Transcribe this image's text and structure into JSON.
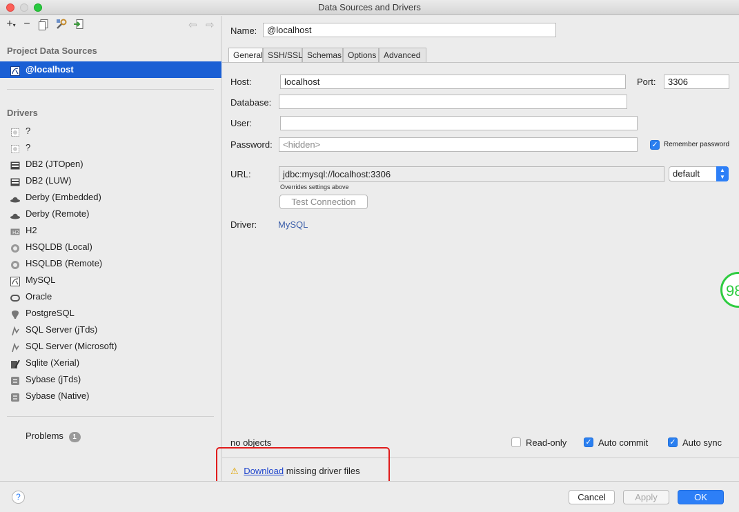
{
  "window": {
    "title": "Data Sources and Drivers"
  },
  "toolbar": {
    "add": "+",
    "add_chevron": "▾",
    "remove": "−"
  },
  "left": {
    "project_title": "Project Data Sources",
    "selected_source": "@localhost",
    "drivers_title": "Drivers",
    "drivers": [
      {
        "label": "?",
        "icon": "generic-driver-icon"
      },
      {
        "label": "?",
        "icon": "generic-driver-icon"
      },
      {
        "label": "DB2 (JTOpen)",
        "icon": "db2-icon"
      },
      {
        "label": "DB2 (LUW)",
        "icon": "db2-icon"
      },
      {
        "label": "Derby (Embedded)",
        "icon": "derby-hat-icon"
      },
      {
        "label": "Derby (Remote)",
        "icon": "derby-hat-icon"
      },
      {
        "label": "H2",
        "icon": "h2-icon"
      },
      {
        "label": "HSQLDB (Local)",
        "icon": "hsqldb-icon"
      },
      {
        "label": "HSQLDB (Remote)",
        "icon": "hsqldb-icon"
      },
      {
        "label": "MySQL",
        "icon": "mysql-icon"
      },
      {
        "label": "Oracle",
        "icon": "oracle-icon"
      },
      {
        "label": "PostgreSQL",
        "icon": "postgresql-icon"
      },
      {
        "label": "SQL Server (jTds)",
        "icon": "sqlserver-icon"
      },
      {
        "label": "SQL Server (Microsoft)",
        "icon": "sqlserver-icon"
      },
      {
        "label": "Sqlite (Xerial)",
        "icon": "sqlite-icon"
      },
      {
        "label": "Sybase (jTds)",
        "icon": "sybase-icon"
      },
      {
        "label": "Sybase (Native)",
        "icon": "sybase-icon"
      }
    ],
    "problems_label": "Problems",
    "problems_count": "1"
  },
  "form": {
    "name_label": "Name:",
    "name_value": "@localhost",
    "tabs": [
      "General",
      "SSH/SSL",
      "Schemas",
      "Options",
      "Advanced"
    ],
    "host_label": "Host:",
    "host_value": "localhost",
    "port_label": "Port:",
    "port_value": "3306",
    "database_label": "Database:",
    "database_value": "",
    "user_label": "User:",
    "user_value": "",
    "password_label": "Password:",
    "password_placeholder": "<hidden>",
    "remember_password": "Remember password",
    "url_label": "URL:",
    "url_value": "jdbc:mysql://localhost:3306",
    "url_note": "Overrides settings above",
    "url_mode": "default",
    "test_connection": "Test Connection",
    "driver_label": "Driver:",
    "driver_value": "MySQL",
    "side_badge": "98",
    "objects_status": "no objects",
    "read_only": "Read-only",
    "auto_commit": "Auto commit",
    "auto_sync": "Auto sync",
    "warning_link": "Download",
    "warning_text": " missing driver files"
  },
  "buttons": {
    "help": "?",
    "cancel": "Cancel",
    "apply": "Apply",
    "ok": "OK"
  },
  "colors": {
    "selection": "#1a5fd4",
    "primary_button": "#2d7ff7",
    "highlight_box": "#e01b1b",
    "badge_green": "#2ecc40"
  }
}
